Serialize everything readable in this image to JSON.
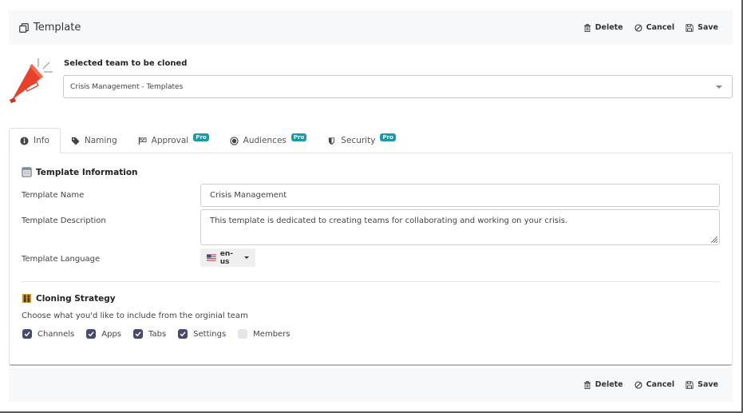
{
  "header": {
    "title": "Template",
    "actions": {
      "delete": "Delete",
      "cancel": "Cancel",
      "save": "Save"
    }
  },
  "clone": {
    "label": "Selected team to be cloned",
    "selected_team": "Crisis Management - Templates"
  },
  "tabs": [
    {
      "label": "Info",
      "icon": "info-icon",
      "active": true,
      "pro": false
    },
    {
      "label": "Naming",
      "icon": "tag-icon",
      "active": false,
      "pro": false
    },
    {
      "label": "Approval",
      "icon": "flag-icon",
      "active": false,
      "pro": true
    },
    {
      "label": "Audiences",
      "icon": "target-icon",
      "active": false,
      "pro": true
    },
    {
      "label": "Security",
      "icon": "shield-icon",
      "active": false,
      "pro": true
    }
  ],
  "pro_badge": "Pro",
  "template_info": {
    "title": "Template Information",
    "name_label": "Template Name",
    "name_value": "Crisis Management",
    "description_label": "Template Description",
    "description_value": "This template is dedicated to creating teams for collaborating and working on your crisis.",
    "language_label": "Template Language",
    "language_value": "en-us"
  },
  "cloning": {
    "title": "Cloning Strategy",
    "hint": "Choose what you'd like to include from the orginial team",
    "options": [
      {
        "label": "Channels",
        "checked": true
      },
      {
        "label": "Apps",
        "checked": true
      },
      {
        "label": "Tabs",
        "checked": true
      },
      {
        "label": "Settings",
        "checked": true
      },
      {
        "label": "Members",
        "checked": false
      }
    ]
  },
  "footer": {
    "actions": {
      "delete": "Delete",
      "cancel": "Cancel",
      "save": "Save"
    }
  },
  "colors": {
    "accent_checkbox": "#474a6e",
    "pro_badge": "#1a9aa6",
    "megaphone": "#e8402a",
    "bar_background": "#f7f8fa"
  }
}
